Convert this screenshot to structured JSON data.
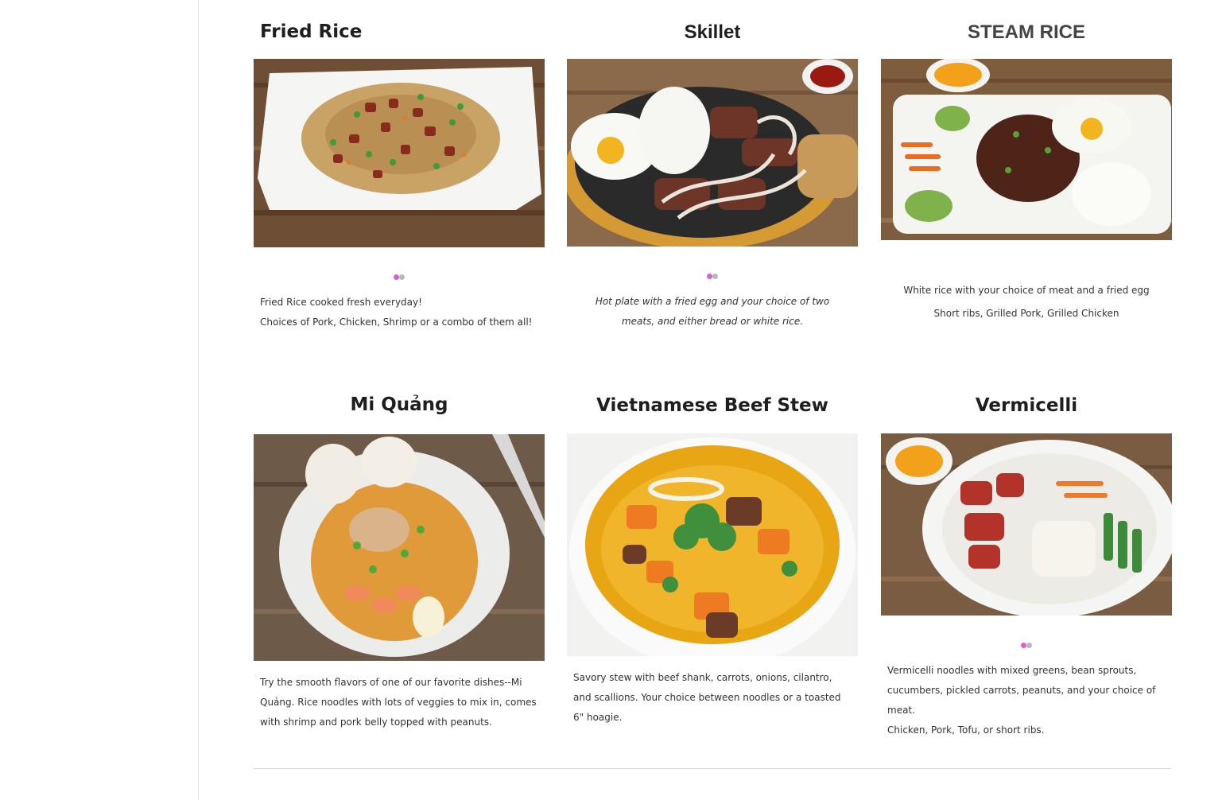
{
  "menu": {
    "row1": [
      {
        "title": "Fried Rice",
        "image_icon": "fried-rice-photo",
        "carousel_dots": 2,
        "description_lines": [
          "Fried Rice cooked fresh everyday!",
          "Choices of Pork, Chicken, Shrimp or a combo of them all!"
        ]
      },
      {
        "title": "Skillet",
        "image_icon": "skillet-photo",
        "carousel_dots": 2,
        "description_lines": [
          "Hot plate with a fried egg and your choice of two meats, and either bread or white rice."
        ]
      },
      {
        "title": "STEAM RICE",
        "image_icon": "steam-rice-photo",
        "description_lines": [
          "White rice with your choice of meat and a fried egg",
          "Short ribs, Grilled Pork, Grilled Chicken"
        ]
      }
    ],
    "row2": [
      {
        "title": "Mi Quảng",
        "image_icon": "mi-quang-photo",
        "description_lines": [
          "Try the smooth flavors of one of our favorite dishes--Mi Quảng. Rice noodles with lots of veggies to mix in, comes with shrimp and pork belly topped with peanuts."
        ]
      },
      {
        "title": "Vietnamese Beef Stew",
        "image_icon": "beef-stew-photo",
        "description_lines": [
          "Savory stew with beef shank, carrots, onions, cilantro, and scallions. Your choice between noodles or a toasted 6\" hoagie."
        ]
      },
      {
        "title": "Vermicelli",
        "image_icon": "vermicelli-photo",
        "carousel_dots": 2,
        "description_lines": [
          "Vermicelli noodles with mixed greens, bean sprouts, cucumbers, pickled carrots, peanuts, and your choice of meat.",
          "Chicken, Pork, Tofu, or short ribs."
        ]
      }
    ]
  },
  "colors": {
    "dot_active": "#e15ad8",
    "dot_idle": "#b8b8b8",
    "wood": "#7a5a3e",
    "plate": "#f4f4f2"
  }
}
